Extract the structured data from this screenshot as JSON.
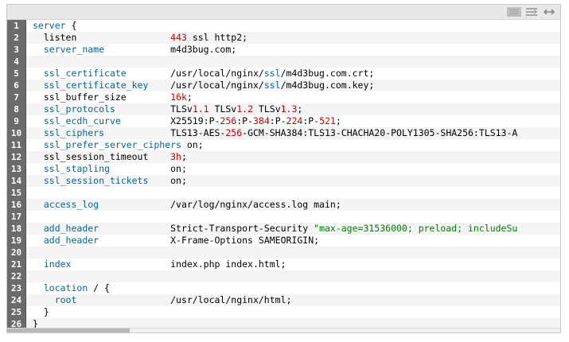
{
  "toolbar": {
    "icons": [
      "view-source-icon",
      "wrap-lines-icon",
      "expand-icon"
    ]
  },
  "lines": [
    {
      "n": "1",
      "parts": [
        [
          "k",
          "server"
        ],
        [
          "p",
          " {"
        ]
      ]
    },
    {
      "n": "2",
      "parts": [
        [
          "p",
          "  "
        ],
        [
          "n",
          "listen"
        ],
        [
          "p",
          "                 "
        ],
        [
          "nm",
          "443"
        ],
        [
          "p",
          " ssl http2;"
        ]
      ]
    },
    {
      "n": "3",
      "parts": [
        [
          "p",
          "  "
        ],
        [
          "k",
          "server_name"
        ],
        [
          "p",
          "            m4d3bug.com;"
        ]
      ]
    },
    {
      "n": "4",
      "parts": []
    },
    {
      "n": "5",
      "parts": [
        [
          "p",
          "  "
        ],
        [
          "k",
          "ssl_certificate"
        ],
        [
          "p",
          "        /usr/local/nginx/"
        ],
        [
          "k",
          "ssl"
        ],
        [
          "p",
          "/m4d3bug.com.crt;"
        ]
      ]
    },
    {
      "n": "6",
      "parts": [
        [
          "p",
          "  "
        ],
        [
          "k",
          "ssl_certificate_key"
        ],
        [
          "p",
          "    /usr/local/nginx/"
        ],
        [
          "k",
          "ssl"
        ],
        [
          "p",
          "/m4d3bug.com.key;"
        ]
      ]
    },
    {
      "n": "7",
      "parts": [
        [
          "p",
          "  "
        ],
        [
          "n",
          "ssl_buffer_size"
        ],
        [
          "p",
          "        "
        ],
        [
          "nm",
          "16k"
        ],
        [
          "p",
          ";"
        ]
      ]
    },
    {
      "n": "8",
      "parts": [
        [
          "p",
          "  "
        ],
        [
          "k",
          "ssl_protocols"
        ],
        [
          "p",
          "          TLSv"
        ],
        [
          "nm",
          "1.1"
        ],
        [
          "p",
          " TLSv"
        ],
        [
          "nm",
          "1.2"
        ],
        [
          "p",
          " TLSv"
        ],
        [
          "nm",
          "1.3"
        ],
        [
          "p",
          ";"
        ]
      ]
    },
    {
      "n": "9",
      "parts": [
        [
          "p",
          "  "
        ],
        [
          "k",
          "ssl_ecdh_curve"
        ],
        [
          "p",
          "         X25519:P-"
        ],
        [
          "nm",
          "256"
        ],
        [
          "p",
          ":P-"
        ],
        [
          "nm",
          "384"
        ],
        [
          "p",
          ":P-"
        ],
        [
          "nm",
          "224"
        ],
        [
          "p",
          ":P-"
        ],
        [
          "nm",
          "521"
        ],
        [
          "p",
          ";"
        ]
      ]
    },
    {
      "n": "10",
      "parts": [
        [
          "p",
          "  "
        ],
        [
          "k",
          "ssl_ciphers"
        ],
        [
          "p",
          "            TLS13-AES-"
        ],
        [
          "nm",
          "256"
        ],
        [
          "p",
          "-GCM-SHA384:TLS13-CHACHA20-POLY1305-SHA256:TLS13-A"
        ]
      ]
    },
    {
      "n": "11",
      "parts": [
        [
          "p",
          "  "
        ],
        [
          "k",
          "ssl_prefer_server_ciphers"
        ],
        [
          "p",
          " on;"
        ]
      ]
    },
    {
      "n": "12",
      "parts": [
        [
          "p",
          "  "
        ],
        [
          "n",
          "ssl_session_timeout"
        ],
        [
          "p",
          "    "
        ],
        [
          "nm",
          "3h"
        ],
        [
          "p",
          ";"
        ]
      ]
    },
    {
      "n": "13",
      "parts": [
        [
          "p",
          "  "
        ],
        [
          "k",
          "ssl_stapling"
        ],
        [
          "p",
          "           on;"
        ]
      ]
    },
    {
      "n": "14",
      "parts": [
        [
          "p",
          "  "
        ],
        [
          "k",
          "ssl_session_tickets"
        ],
        [
          "p",
          "    on;"
        ]
      ]
    },
    {
      "n": "15",
      "parts": []
    },
    {
      "n": "16",
      "parts": [
        [
          "p",
          "  "
        ],
        [
          "k",
          "access_log"
        ],
        [
          "p",
          "             /var/log/nginx/access.log main;"
        ]
      ]
    },
    {
      "n": "17",
      "parts": []
    },
    {
      "n": "18",
      "parts": [
        [
          "p",
          "  "
        ],
        [
          "k",
          "add_header"
        ],
        [
          "p",
          "             Strict-Transport-Security "
        ],
        [
          "s",
          "\"max-age=31536000; preload; includeSu"
        ]
      ]
    },
    {
      "n": "19",
      "parts": [
        [
          "p",
          "  "
        ],
        [
          "k",
          "add_header"
        ],
        [
          "p",
          "             X-Frame-Options SAMEORIGIN;"
        ]
      ]
    },
    {
      "n": "20",
      "parts": []
    },
    {
      "n": "21",
      "parts": [
        [
          "p",
          "  "
        ],
        [
          "k",
          "index"
        ],
        [
          "p",
          "                  index.php index.html;"
        ]
      ]
    },
    {
      "n": "22",
      "parts": []
    },
    {
      "n": "23",
      "parts": [
        [
          "p",
          "  "
        ],
        [
          "k",
          "location"
        ],
        [
          "p",
          " / {"
        ]
      ]
    },
    {
      "n": "24",
      "parts": [
        [
          "p",
          "    "
        ],
        [
          "k",
          "root"
        ],
        [
          "p",
          "                 /usr/local/nginx/html;"
        ]
      ]
    },
    {
      "n": "25",
      "parts": [
        [
          "p",
          "  }"
        ]
      ]
    },
    {
      "n": "26",
      "parts": [
        [
          "p",
          "}"
        ]
      ]
    }
  ]
}
